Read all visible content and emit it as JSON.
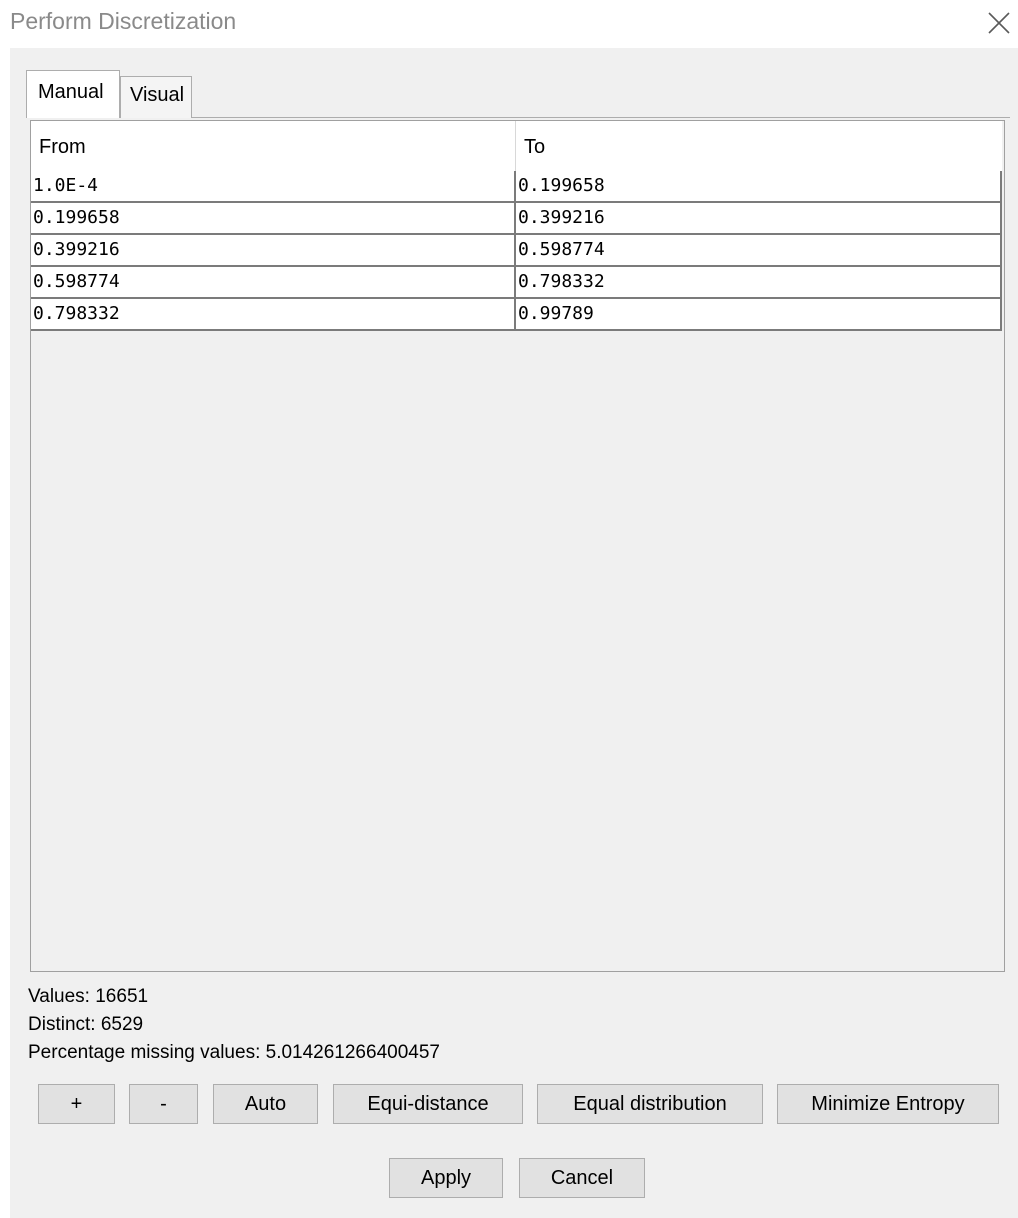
{
  "window": {
    "title": "Perform Discretization",
    "close_icon": "close-icon"
  },
  "tabs": [
    {
      "label": "Manual",
      "active": true
    },
    {
      "label": "Visual",
      "active": false
    }
  ],
  "table": {
    "columns": [
      "From",
      "To"
    ],
    "rows": [
      [
        "1.0E-4",
        "0.199658"
      ],
      [
        "0.199658",
        "0.399216"
      ],
      [
        "0.399216",
        "0.598774"
      ],
      [
        "0.598774",
        "0.798332"
      ],
      [
        "0.798332",
        "0.99789"
      ]
    ]
  },
  "stats": {
    "values": "Values: 16651",
    "distinct": "Distinct: 6529",
    "missing": "Percentage missing values: 5.014261266400457"
  },
  "buttons": {
    "add": "+",
    "remove": "-",
    "auto": "Auto",
    "equi_distance": "Equi-distance",
    "equal_distribution": "Equal distribution",
    "minimize_entropy": "Minimize Entropy",
    "apply": "Apply",
    "cancel": "Cancel"
  }
}
